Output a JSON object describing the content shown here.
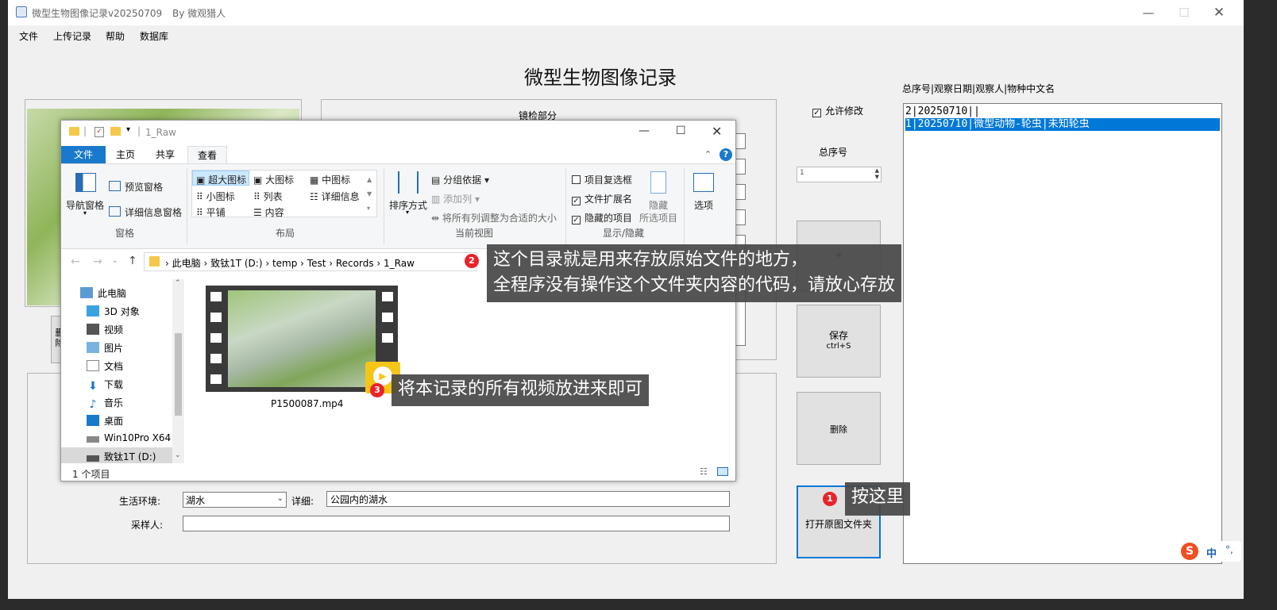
{
  "window": {
    "title": "微型生物图像记录v20250709",
    "author": "By 微观猎人"
  },
  "menu": [
    "文件",
    "上传记录",
    "帮助",
    "数据库"
  ],
  "app_title": "微型生物图像记录",
  "microscope": {
    "label": "镜检部分"
  },
  "side_button_partial": "删\n除",
  "habitat": {
    "env_label": "生活环境:",
    "env_value": "湖水",
    "detail_label": "详细:",
    "detail_value": "公园内的湖水",
    "collector_label": "采样人:",
    "collector_value": ""
  },
  "controls": {
    "allow_edit": "允许修改",
    "allow_edit_checked": true,
    "serial_label": "总序号",
    "serial_value": "1",
    "plus_button": "+",
    "save_button": "保存",
    "save_shortcut": "ctrl+S",
    "delete_button": "删除",
    "open_folder_button": "打开原图文件夹"
  },
  "records": {
    "header": "总序号|观察日期|观察人|物种中文名",
    "rows": [
      {
        "text": "2|20250710||",
        "selected": false
      },
      {
        "text": "1|20250710|微型动物-轮虫|未知轮虫",
        "selected": true
      }
    ]
  },
  "explorer": {
    "title": "1_Raw",
    "tabs": [
      "文件",
      "主页",
      "共享",
      "查看"
    ],
    "active_tab": "查看",
    "ribbon": {
      "pane": {
        "nav_pane": "导航窗格",
        "preview_pane": "预览窗格",
        "details_pane": "详细信息窗格",
        "section": "窗格"
      },
      "layout": {
        "items": [
          "超大图标",
          "大图标",
          "中图标",
          "小图标",
          "列表",
          "详细信息",
          "平铺",
          "内容"
        ],
        "section": "布局"
      },
      "current_view": {
        "sort": "排序方式",
        "group_by": "分组依据",
        "add_column": "添加列",
        "fit_columns": "将所有列调整为合适的大小",
        "section": "当前视图"
      },
      "show_hide": {
        "item_checkbox": "项目复选框",
        "file_ext": "文件扩展名",
        "hidden_items": "隐藏的项目",
        "hide_selected_1": "隐藏",
        "hide_selected_2": "所选项目",
        "section": "显示/隐藏",
        "item_checkbox_checked": false,
        "file_ext_checked": true,
        "hidden_items_checked": true
      },
      "options": "选项"
    },
    "breadcrumb": [
      "此电脑",
      "致钛1T (D:)",
      "temp",
      "Test",
      "Records",
      "1_Raw"
    ],
    "nav": [
      "此电脑",
      "3D 对象",
      "视频",
      "图片",
      "文档",
      "下载",
      "音乐",
      "桌面",
      "Win10Pro X64 (",
      "致钛1T (D:)"
    ],
    "file": {
      "name": "P1500087.mp4"
    },
    "status": "1 个项目"
  },
  "callouts": [
    {
      "num": "1",
      "text": "按这里"
    },
    {
      "num": "2",
      "text": "这个目录就是用来存放原始文件的地方，\n全程序没有操作这个文件夹内容的代码，请放心存放"
    },
    {
      "num": "3",
      "text": "将本记录的所有视频放进来即可"
    }
  ],
  "ime": {
    "label": "中",
    "extra": "°,"
  },
  "colors": {
    "select_blue": "#0078d7",
    "ribbon_file_tab": "#1979ca",
    "callout_bg": "#464646",
    "badge_red": "#e8232a"
  }
}
